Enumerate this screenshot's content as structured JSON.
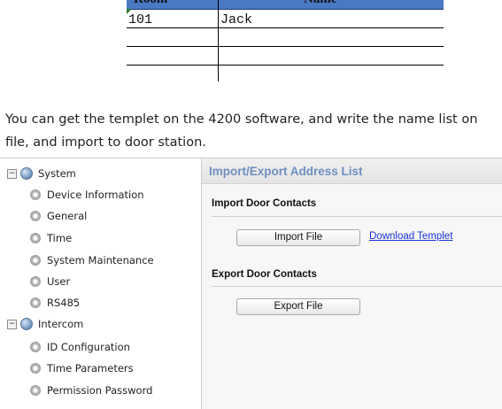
{
  "address_table": {
    "headers": [
      "Room",
      "Name"
    ],
    "rows": [
      [
        "101",
        "Jack"
      ],
      [
        "",
        ""
      ],
      [
        "",
        ""
      ],
      [
        "",
        ""
      ]
    ]
  },
  "instructions": {
    "line1": "You can get the templet on the 4200 software, and write the name list on",
    "line2": "file, and import to door station."
  },
  "sidebar": {
    "groups": [
      {
        "label": "System",
        "expanded": true,
        "items": [
          "Device Information",
          "General",
          "Time",
          "System Maintenance",
          "User",
          "RS485"
        ]
      },
      {
        "label": "Intercom",
        "expanded": true,
        "items": [
          "ID Configuration",
          "Time Parameters",
          "Permission Password"
        ]
      }
    ],
    "toggle_symbol": "−"
  },
  "main": {
    "title": "Import/Export Address List",
    "import_section": {
      "title": "Import Door Contacts",
      "button": "Import File",
      "link": "Download Templet"
    },
    "export_section": {
      "title": "Export Door Contacts",
      "button": "Export File"
    }
  },
  "colors": {
    "table_header": "#4a79c4",
    "panel_title": "#6f8fbf",
    "link": "#1a33d8"
  }
}
